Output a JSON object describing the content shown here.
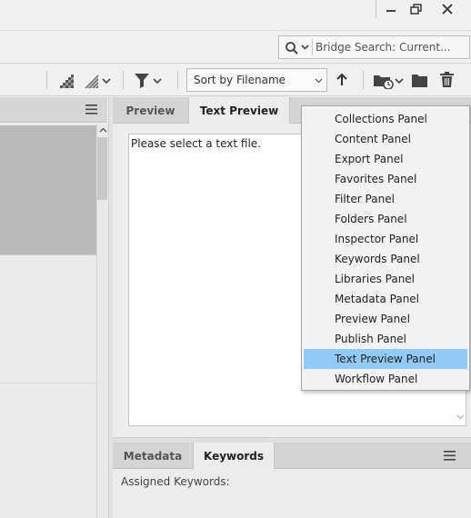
{
  "search": {
    "placeholder": "Bridge Search: Current..."
  },
  "toolbar": {
    "sort_label": "Sort by Filename"
  },
  "preview_panel": {
    "tabs": [
      {
        "label": "Preview"
      },
      {
        "label": "Text Preview"
      }
    ],
    "message": "Please select a text file."
  },
  "lower_panel": {
    "tabs": [
      {
        "label": "Metadata"
      },
      {
        "label": "Keywords"
      }
    ],
    "assigned_label": "Assigned Keywords:"
  },
  "menu": {
    "items": [
      {
        "label": "Collections Panel"
      },
      {
        "label": "Content Panel"
      },
      {
        "label": "Export Panel"
      },
      {
        "label": "Favorites Panel"
      },
      {
        "label": "Filter Panel"
      },
      {
        "label": "Folders Panel"
      },
      {
        "label": "Inspector Panel"
      },
      {
        "label": "Keywords Panel"
      },
      {
        "label": "Libraries Panel"
      },
      {
        "label": "Metadata Panel"
      },
      {
        "label": "Preview Panel"
      },
      {
        "label": "Publish Panel"
      },
      {
        "label": "Text Preview Panel"
      },
      {
        "label": "Workflow Panel"
      }
    ],
    "highlighted": "Text Preview Panel",
    "highlight_color": "#91c9f7"
  },
  "icons": [
    "minimize-icon",
    "restore-icon",
    "close-icon",
    "search-icon",
    "chevron-down-icon",
    "quality-filter-icon",
    "sort-filter-icon",
    "filter-icon",
    "ascending-arrow-icon",
    "recent-folder-icon",
    "folder-icon",
    "trash-icon",
    "panel-menu-icon"
  ]
}
